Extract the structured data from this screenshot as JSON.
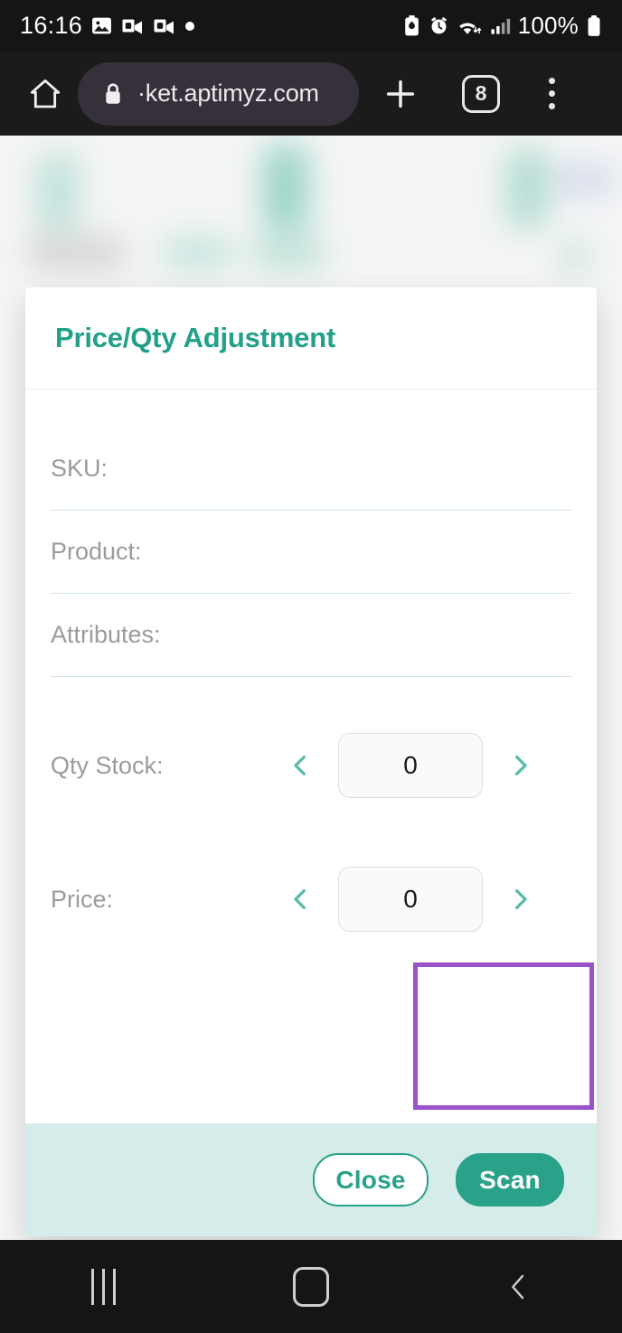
{
  "status_bar": {
    "clock": "16:16",
    "battery_percent": "100%",
    "left_icons": [
      "photo-icon",
      "outlook-icon",
      "outlook-icon",
      "dot-icon"
    ],
    "right_icons": [
      "battery-saver-icon",
      "alarm-icon",
      "wifi-icon",
      "signal-icon",
      "battery-icon"
    ]
  },
  "browser": {
    "home_icon": "home-icon",
    "lock_icon": "lock-icon",
    "url": "·ket.aptimyz.com",
    "new_tab_icon": "plus-icon",
    "tab_count": "8",
    "menu_icon": "more-vertical-icon"
  },
  "modal": {
    "title": "Price/Qty Adjustment",
    "fields": [
      {
        "label": "SKU:",
        "value": ""
      },
      {
        "label": "Product:",
        "value": ""
      },
      {
        "label": "Attributes:",
        "value": ""
      }
    ],
    "steppers": [
      {
        "label": "Qty Stock:",
        "value": "0",
        "dec_icon": "chevron-left-icon",
        "inc_icon": "chevron-right-icon"
      },
      {
        "label": "Price:",
        "value": "0",
        "dec_icon": "chevron-left-icon",
        "inc_icon": "chevron-right-icon"
      }
    ],
    "footer": {
      "close_label": "Close",
      "scan_label": "Scan"
    }
  },
  "nav_bar": {
    "recents_icon": "recents-icon",
    "home_icon": "home-square-icon",
    "back_icon": "back-chevron-icon"
  },
  "colors": {
    "accent_teal": "#2aa189",
    "light_teal": "#56bba8",
    "footer_bg": "#d5ecea",
    "highlight_purple": "#9b51c9",
    "chrome_bg": "#1b1b1b",
    "status_bg": "#151515",
    "page_bg": "#f4f5f5"
  }
}
